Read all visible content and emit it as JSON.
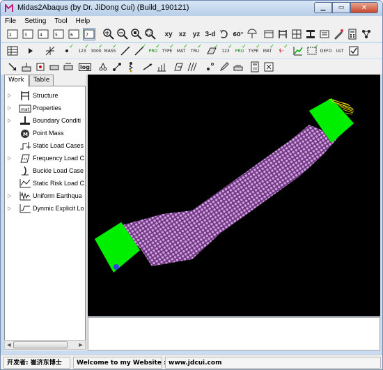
{
  "window": {
    "title": "Midas2Abaqus (by Dr. JiDong Cui) (Build_190121)"
  },
  "menu": [
    "File",
    "Setting",
    "Tool",
    "Help"
  ],
  "toolbar1": [
    "X2",
    "X3",
    "X4",
    "X5",
    "X6",
    "X7",
    "zoom-in",
    "zoom-out",
    "zoom-fit",
    "zoom-window",
    "xy",
    "xz",
    "yz",
    "3-d",
    "rotate",
    "angle",
    "umbrella",
    "tape",
    "frame",
    "grid",
    "section",
    "material",
    "calc",
    "network"
  ],
  "toolbar2": [
    "table",
    "play",
    "axis",
    "node",
    "node-num",
    "node-num2",
    "line",
    "beam",
    "line2",
    "line3",
    "line4",
    "line5",
    "truss",
    "plate",
    "plate2",
    "solid",
    "solid2",
    "load",
    "chart",
    "dash-box",
    "defo",
    "check"
  ],
  "toolbar3": [
    "arrow",
    "disp",
    "support",
    "scale",
    "log",
    "pin",
    "link",
    "spring",
    "spring2",
    "spring3",
    "axis2",
    "shell",
    "point",
    "pencil",
    "page",
    "calc2",
    "close2"
  ],
  "tabs": {
    "work": "Work",
    "table": "Table"
  },
  "tree": [
    {
      "label": "Structure",
      "icon": "structure-icon",
      "expandable": true
    },
    {
      "label": "Properties",
      "icon": "properties-icon",
      "expandable": true
    },
    {
      "label": "Boundary Conditi",
      "icon": "boundary-icon",
      "expandable": true
    },
    {
      "label": "Point Mass",
      "icon": "point-mass-icon",
      "expandable": false
    },
    {
      "label": "Static Load Cases",
      "icon": "static-load-icon",
      "expandable": false
    },
    {
      "label": "Frequency Load C",
      "icon": "frequency-icon",
      "expandable": true
    },
    {
      "label": "Buckle Load Case",
      "icon": "buckle-icon",
      "expandable": false
    },
    {
      "label": "Static Risk Load C",
      "icon": "risk-load-icon",
      "expandable": false
    },
    {
      "label": "Uniform Earthqua",
      "icon": "earthquake-icon",
      "expandable": true
    },
    {
      "label": "Dynmic Explicit Lo",
      "icon": "dynamic-icon",
      "expandable": true
    }
  ],
  "status": {
    "developer": "开发者: 崔济东博士",
    "welcome": "Welcome to my Website :",
    "website": "www.jdcui.com"
  },
  "colors": {
    "mesh": "#d89ee8",
    "ends": "#00ff00",
    "support": "#3344dd",
    "tip": "#f0e000"
  }
}
